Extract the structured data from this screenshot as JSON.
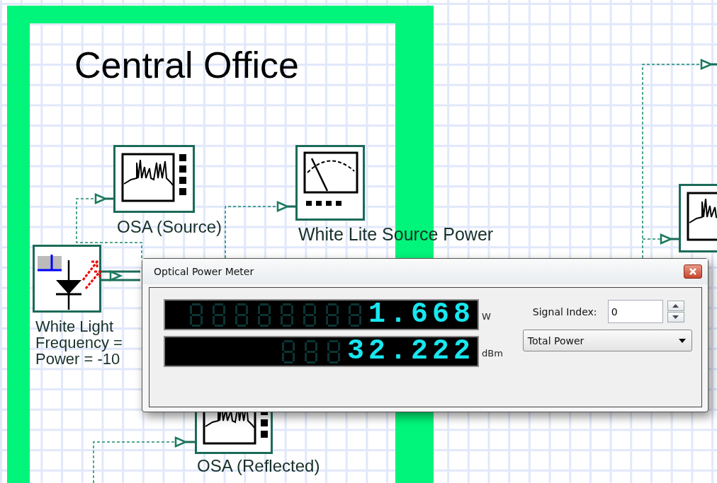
{
  "canvas": {
    "title": "Central Office",
    "components": [
      {
        "kind": "osa",
        "label_lines": [
          "OSA (Source)"
        ]
      },
      {
        "kind": "power_meter",
        "label_lines": [
          "White Lite Source Power"
        ]
      },
      {
        "kind": "light_source",
        "label_lines": [
          "White Light",
          "Frequency =",
          "Power = -10"
        ]
      },
      {
        "kind": "osa",
        "label_lines": [
          "OSA (Reflected)"
        ]
      },
      {
        "kind": "osa"
      }
    ]
  },
  "dialog": {
    "title": "Optical Power Meter",
    "readings": [
      {
        "value": "1.668",
        "unit": "W"
      },
      {
        "value": "32.222",
        "unit": "dBm"
      }
    ],
    "signal_index": {
      "label": "Signal Index:",
      "value": "0"
    },
    "mode": "Total Power"
  }
}
